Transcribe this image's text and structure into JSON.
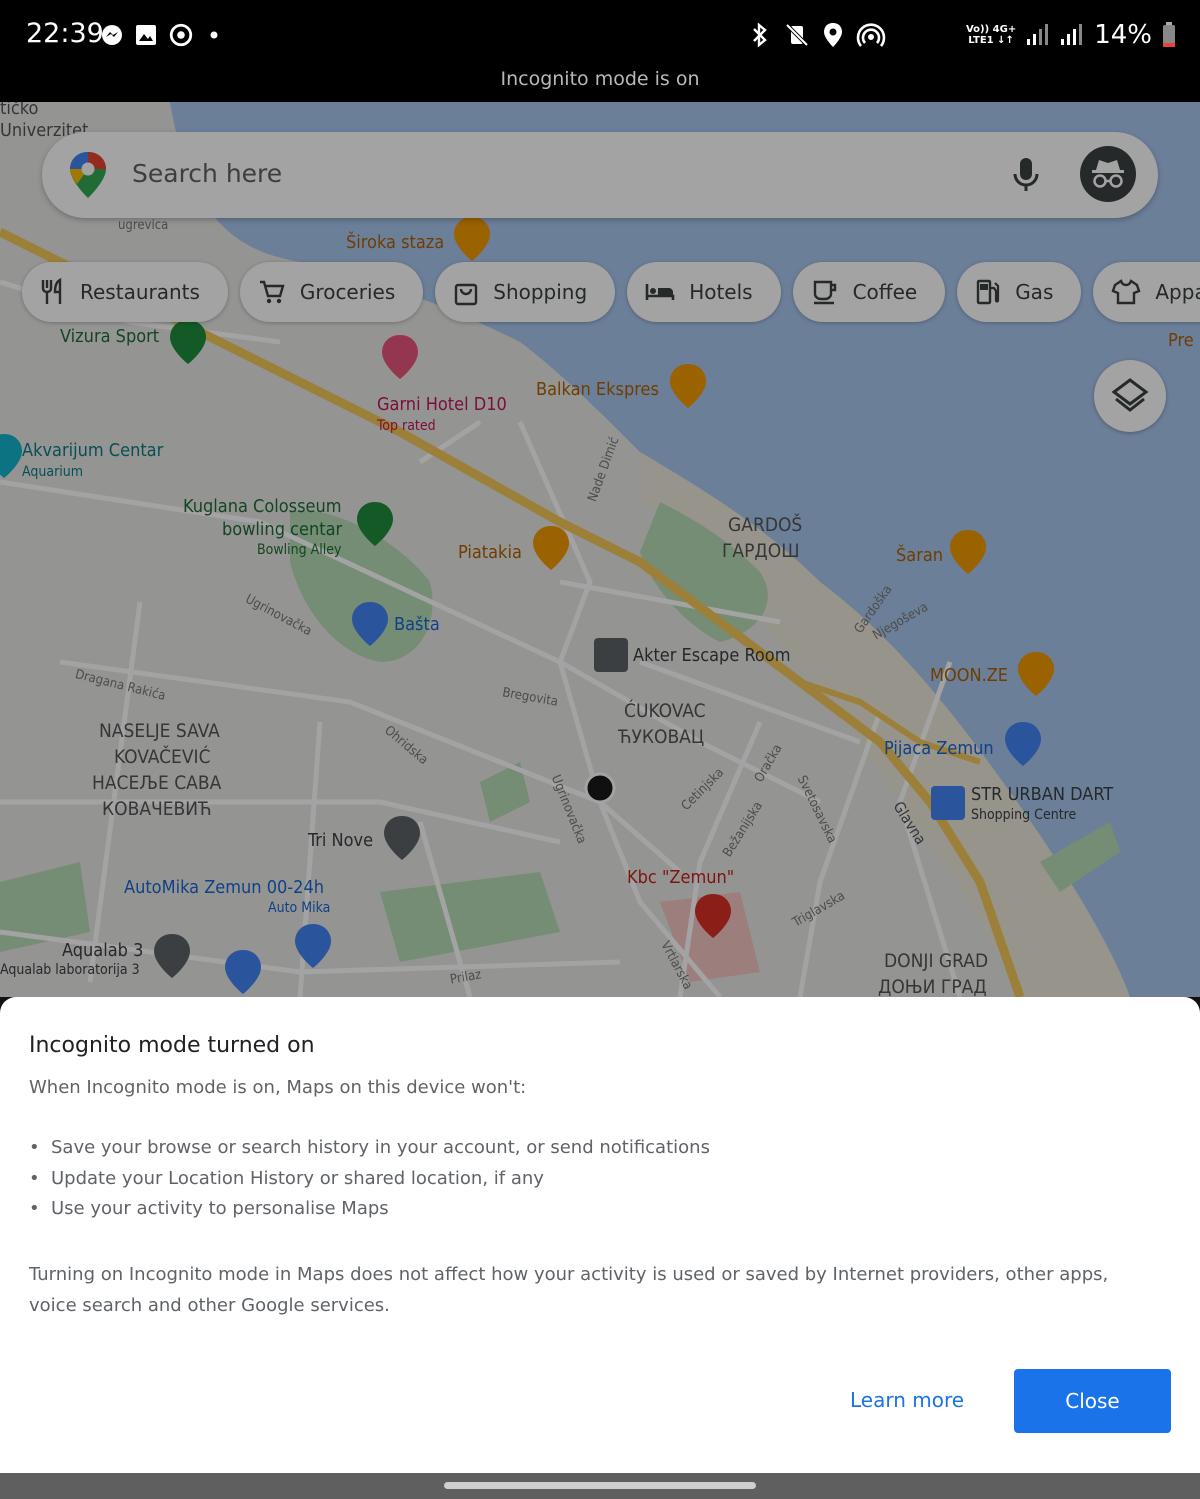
{
  "status_bar": {
    "time": "22:39",
    "left_icons": [
      "messenger-icon",
      "gallery-icon",
      "sync-icon",
      "dot-icon"
    ],
    "center_icons": [
      "bluetooth-icon",
      "mute-vibrate-icon",
      "location-icon",
      "hotspot-icon"
    ],
    "network_line1": "Vo)) 4G+",
    "network_line2": "LTE1 ↓↑",
    "battery": "14%"
  },
  "incognito_banner": "Incognito mode is on",
  "search": {
    "placeholder": "Search here",
    "icons": [
      "maps-pin-icon",
      "mic-icon",
      "incognito-icon"
    ]
  },
  "chips": [
    {
      "label": "Restaurants",
      "icon": "fork-knife-icon"
    },
    {
      "label": "Groceries",
      "icon": "cart-icon"
    },
    {
      "label": "Shopping",
      "icon": "shopping-bag-icon"
    },
    {
      "label": "Hotels",
      "icon": "bed-icon"
    },
    {
      "label": "Coffee",
      "icon": "coffee-cup-icon"
    },
    {
      "label": "Gas",
      "icon": "gas-pump-icon"
    },
    {
      "label": "Appar",
      "icon": "shirt-icon"
    }
  ],
  "map_labels": {
    "ticko": "tičko",
    "univerzitet": "Univerzitet",
    "ugrevica": "ugrevica",
    "siroka_staza": "Široka staza",
    "vizura_sport": "Vizura Sport",
    "pre": "Pre",
    "garni_hotel": "Garni Hotel D10",
    "top_rated": "Top rated",
    "balkan_ekspres": "Balkan Ekspres",
    "akvarijum": "Akvarijum Centar",
    "aquarium": "Aquarium",
    "kuglana1": "Kuglana Colosseum",
    "kuglana2": "bowling centar",
    "bowling_alley": "Bowling Alley",
    "nade_dimic": "Nade Dimić",
    "piatakia": "Piatakia",
    "gardos": "GARDOŠ",
    "gardos_cyr": "ГАРДОШ",
    "saran": "Šaran",
    "gardoska": "Gardoška",
    "njegoseva": "Njegoševa",
    "ugrinovacka": "Ugrinovačka",
    "basta": "Bašta",
    "akter": "Akter Escape Room",
    "dragana": "Dragana Rakića",
    "bregovita": "Bregovita",
    "cukovac": "ĆUKOVAC",
    "cukovac_cyr": "ЋУКОВАЦ",
    "moon": "MOON.ZE",
    "naselje1": "NASELJE SAVA",
    "naselje2": "KOVAČEVIĆ",
    "naselje3": "НАСЕЉЕ САВА",
    "naselje4": "КОВАЧЕВИЋ",
    "ohridska": "Ohridska",
    "pijaca": "Pijaca Zemun",
    "str_urban": "STR URBAN DART",
    "shopping_centre": "Shopping Centre",
    "ugrinovacka2": "Ugrinovačka",
    "cetinjska": "Cetinjska",
    "oracka": "Oračka",
    "svetosavska": "Svetosavska",
    "bezanijska": "Bežanijska",
    "glavna": "Glavna",
    "tri_nove": "Tri Nove",
    "kbc": "Kbc \"Zemun\"",
    "automika": "AutoMika Zemun 00-24h",
    "auto_mika": "Auto Mika",
    "triglavska": "Triglavska",
    "aqualab": "Aqualab 3",
    "aqualab_lab": "Aqualab laboratorija 3",
    "donji": "DONJI GRAD",
    "donji_cyr": "ДОЊИ ГРАД",
    "prilaz": "Prilaz",
    "vrtlarska": "Vrtlarska"
  },
  "sheet": {
    "title": "Incognito mode turned on",
    "intro": "When Incognito mode is on, Maps on this device won't:",
    "bullets": [
      "Save your browse or search history in your account, or send notifications",
      "Update your Location History or shared location, if any",
      "Use your activity to personalise Maps"
    ],
    "note": "Turning on Incognito mode in Maps does not affect how your activity is used or saved by Internet providers, other apps, voice search and other Google services.",
    "learn_more": "Learn more",
    "close": "Close"
  },
  "colors": {
    "accent": "#1a73e8",
    "road_major": "#f5c85a",
    "water": "#a9c7f0",
    "park": "#b7dbb8",
    "pin_restaurant": "#f29900",
    "pin_hotel": "#e8557a",
    "pin_shopping": "#4285f4",
    "pin_park": "#1e8e3e",
    "pin_hospital": "#d93025"
  }
}
